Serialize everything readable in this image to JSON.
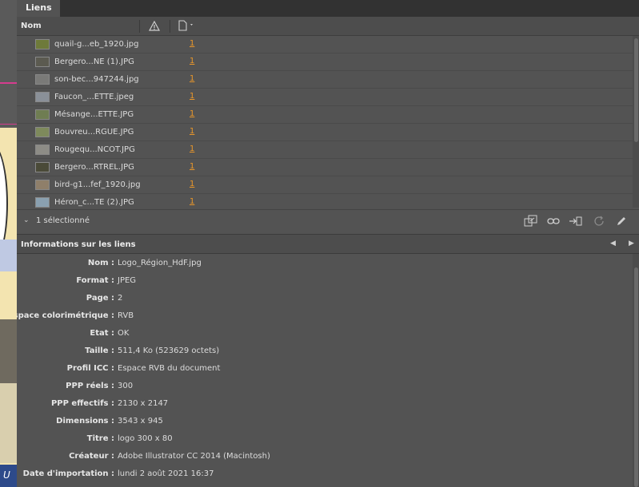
{
  "tab": {
    "label": "Liens"
  },
  "columns": {
    "name": "Nom"
  },
  "links": [
    {
      "name": "quail-g...eb_1920.jpg",
      "page": "1",
      "thumb_color": "#6e7a3a"
    },
    {
      "name": "Bergero...NE (1).JPG",
      "page": "1",
      "thumb_color": "#5b5a50"
    },
    {
      "name": "son-bec...947244.jpg",
      "page": "1",
      "thumb_color": "#7a7a78"
    },
    {
      "name": "Faucon_...ETTE.jpeg",
      "page": "1",
      "thumb_color": "#8a9098"
    },
    {
      "name": "Mésange...ETTE.JPG",
      "page": "1",
      "thumb_color": "#6f7d52"
    },
    {
      "name": "Bouvreu...RGUE.JPG",
      "page": "1",
      "thumb_color": "#7e8a5c"
    },
    {
      "name": "Rougequ...NCOT.JPG",
      "page": "1",
      "thumb_color": "#8d8c86"
    },
    {
      "name": "Bergero...RTREL.JPG",
      "page": "1",
      "thumb_color": "#4a4a38"
    },
    {
      "name": "bird-g1...fef_1920.jpg",
      "page": "1",
      "thumb_color": "#8f7f6a"
    },
    {
      "name": "Héron_c...TE (2).JPG",
      "page": "1",
      "thumb_color": "#8aa0b0"
    }
  ],
  "selection": {
    "text": "1 sélectionné"
  },
  "info": {
    "title": "Informations sur les liens",
    "rows": [
      {
        "label": "Nom :",
        "value": "Logo_Région_HdF.jpg"
      },
      {
        "label": "Format :",
        "value": "JPEG"
      },
      {
        "label": "Page :",
        "value": "2"
      },
      {
        "label": "Espace colorimétrique :",
        "value": "RVB"
      },
      {
        "label": "Etat :",
        "value": "OK"
      },
      {
        "label": "Taille :",
        "value": "511,4 Ko (523629 octets)"
      },
      {
        "label": "Profil ICC :",
        "value": "Espace RVB du document"
      },
      {
        "label": "PPP réels :",
        "value": "300"
      },
      {
        "label": "PPP effectifs :",
        "value": "2130 x 2147"
      },
      {
        "label": "Dimensions :",
        "value": "3543 x 945"
      },
      {
        "label": "Titre :",
        "value": "logo 300 x 80"
      },
      {
        "label": "Créateur :",
        "value": "Adobe Illustrator CC 2014 (Macintosh)"
      },
      {
        "label": "Date d'importation :",
        "value": "lundi 2 août 2021 16:37"
      }
    ]
  },
  "document_strip": {
    "text": "U"
  },
  "colors": {
    "accent_page_link": "#e8962a",
    "panel_bg": "#535353"
  }
}
